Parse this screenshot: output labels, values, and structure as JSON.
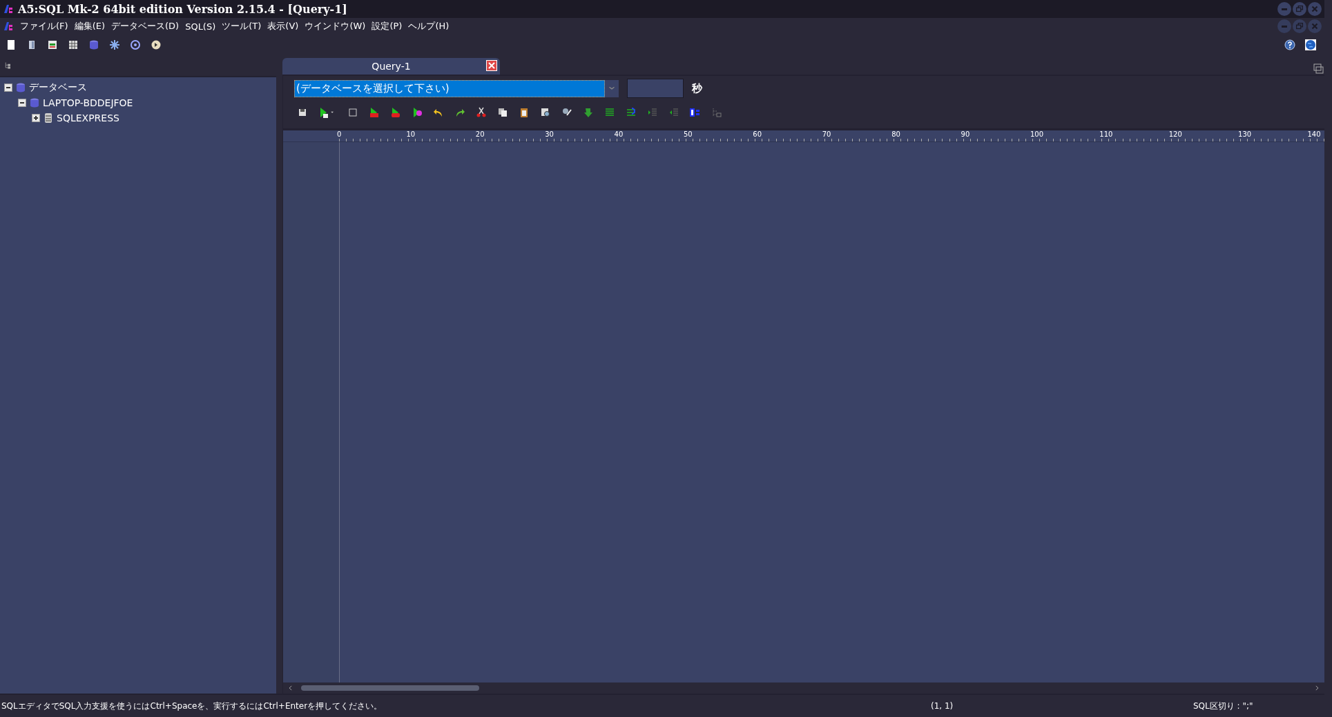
{
  "window": {
    "title": "A5:SQL Mk-2 64bit edition Version 2.15.4 - [Query-1]"
  },
  "menu": [
    "ファイル(F)",
    "編集(E)",
    "データベース(D)",
    "SQL(S)",
    "ツール(T)",
    "表示(V)",
    "ウインドウ(W)",
    "設定(P)",
    "ヘルプ(H)"
  ],
  "tree": [
    {
      "label": "データベース",
      "kind": "group",
      "expanded": true,
      "children": [
        {
          "label": "LAPTOP-BDDEJFOE",
          "kind": "group",
          "expanded": true,
          "children": [
            {
              "label": "SQLEXPRESS",
              "kind": "server",
              "expanded": false
            }
          ]
        }
      ]
    }
  ],
  "tabs": [
    {
      "label": "Query-1",
      "selected": true
    }
  ],
  "database_select": {
    "value": "(データベースを選択して下さい)"
  },
  "timeout": {
    "unit": "秒"
  },
  "ruler": [
    "0",
    "10",
    "20",
    "30",
    "40",
    "50",
    "60",
    "70",
    "80",
    "90",
    "100",
    "110",
    "120",
    "130",
    "140"
  ],
  "status_bar": {
    "message": "SQLエディタでSQL入力支援を使うにはCtrl+Spaceを、実行するにはCtrl+Enterを押してください。",
    "position": "(1, 1)",
    "delimiter": "SQL区切り : \";\""
  }
}
